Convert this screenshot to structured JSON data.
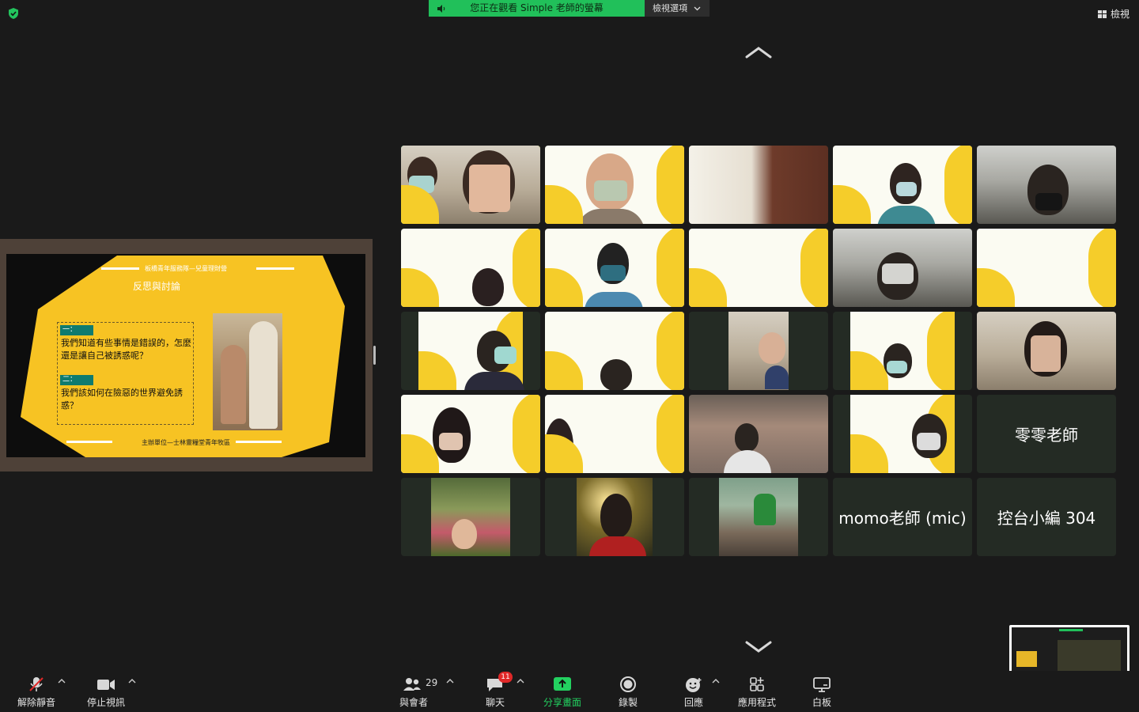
{
  "top_bar": {
    "banner_text": "您正在觀看 Simple 老師的螢幕",
    "view_options_label": "檢視選項",
    "view_label": "檢視"
  },
  "shared_slide": {
    "header": "板橋青年服務隊—兒童理財營",
    "title": "反思與討論",
    "q1_tag": "一：",
    "q1_text": "我們知道有些事情是錯誤的，怎麼還是讓自己被誘惑呢？",
    "q2_tag": "二：",
    "q2_text": "我們該如何在險惡的世界避免誘惑？",
    "footer": "主辦單位—士林靈糧堂青年牧區"
  },
  "participants": [
    {
      "name": "",
      "style": "active"
    },
    {
      "name": "",
      "style": "video"
    },
    {
      "name": "",
      "style": "video"
    },
    {
      "name": "",
      "style": "video"
    },
    {
      "name": "",
      "style": "video"
    },
    {
      "name": "",
      "style": "video"
    },
    {
      "name": "",
      "style": "video"
    },
    {
      "name": "",
      "style": "video"
    },
    {
      "name": "",
      "style": "video"
    },
    {
      "name": "",
      "style": "video"
    },
    {
      "name": "",
      "style": "video"
    },
    {
      "name": "",
      "style": "video"
    },
    {
      "name": "",
      "style": "video"
    },
    {
      "name": "",
      "style": "video"
    },
    {
      "name": "",
      "style": "video"
    },
    {
      "name": "",
      "style": "video"
    },
    {
      "name": "",
      "style": "video"
    },
    {
      "name": "",
      "style": "video"
    },
    {
      "name": "",
      "style": "video"
    },
    {
      "name": "零零老師",
      "style": "name"
    },
    {
      "name": "",
      "style": "photo"
    },
    {
      "name": "",
      "style": "photo"
    },
    {
      "name": "",
      "style": "photo"
    },
    {
      "name": "momo老師 (mic)",
      "style": "name"
    },
    {
      "name": "控台小編 304",
      "style": "name"
    }
  ],
  "toolbar": {
    "unmute": "解除靜音",
    "stop_video": "停止視訊",
    "participants": "與會者",
    "participant_count": "29",
    "chat": "聊天",
    "chat_badge": "11",
    "share_screen": "分享畫面",
    "record": "錄製",
    "reactions": "回應",
    "apps": "應用程式",
    "whiteboard": "白板",
    "mute_level": "10"
  },
  "colors": {
    "share_green": "#21c05a",
    "active_speaker": "#23d160",
    "slide_yellow": "#f7c323",
    "tag_teal": "#0f7b6f",
    "badge_red": "#e02828"
  }
}
